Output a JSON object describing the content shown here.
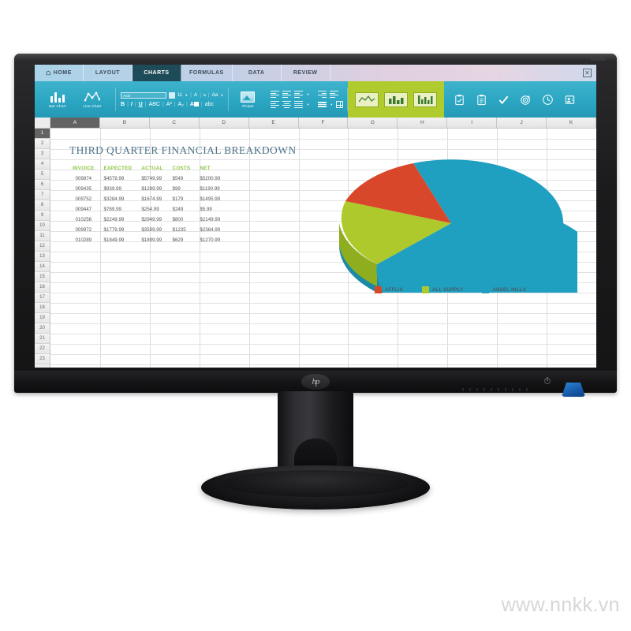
{
  "product": {
    "brand": "hp",
    "model_text": "N246v",
    "power_icon": "power-icon"
  },
  "screen": {
    "tabs": [
      {
        "label": "HOME",
        "icon": "home-icon",
        "active": false
      },
      {
        "label": "LAYOUT",
        "icon": "",
        "active": false
      },
      {
        "label": "CHARTS",
        "icon": "",
        "active": true
      },
      {
        "label": "FORMULAS",
        "icon": "",
        "active": false
      },
      {
        "label": "DATA",
        "icon": "",
        "active": false
      },
      {
        "label": "REVIEW",
        "icon": "",
        "active": false
      }
    ],
    "close_label": "✕",
    "ribbon": {
      "bar_chart_label": "Bar Chart",
      "line_chart_label": "Line Chart",
      "font_name": "Arial",
      "font_size": "11",
      "bold": "B",
      "italic": "I",
      "underline": "U",
      "strikethrough": "ABC",
      "superscript": "A²",
      "subscript": "A₂",
      "font_color_label": "A",
      "lowercase_label": "abc",
      "grow_font": "A",
      "shrink_font": "a",
      "change_case": "Aa",
      "picture_label": "Picture",
      "chart_chips": [
        "line-chart-chip",
        "bar-chart-chip",
        "column-chart-chip"
      ],
      "right_icons": [
        "clipboard-check-icon",
        "clipboard-list-icon",
        "check-icon",
        "target-icon",
        "clock-icon",
        "contact-card-icon"
      ]
    },
    "columns": [
      "A",
      "B",
      "C",
      "D",
      "E",
      "F",
      "G",
      "H",
      "I",
      "J",
      "K"
    ],
    "selected_column": "A",
    "rows": [
      1,
      2,
      3,
      4,
      5,
      6,
      7,
      8,
      9,
      10,
      11,
      12,
      13,
      14,
      15,
      16,
      17,
      18,
      19,
      20,
      21,
      22,
      23
    ],
    "selected_row": 1,
    "sheet_title": "THIRD QUARTER FINANCIAL BREAKDOWN",
    "table": {
      "headers": [
        "INVOICE",
        "EXPECTED",
        "ACTUAL",
        "COSTS",
        "NET"
      ],
      "rows": [
        [
          "009874",
          "$4579.99",
          "$5749.99",
          "$549",
          "$5200.99"
        ],
        [
          "009435",
          "$939.99",
          "$1289.99",
          "$99",
          "$1190.99"
        ],
        [
          "009752",
          "$3284.99",
          "$1674.99",
          "$179",
          "$1495.99"
        ],
        [
          "009447",
          "$789.99",
          "$254.99",
          "$249",
          "$5.99"
        ],
        [
          "010256",
          "$2249.99",
          "$2949.99",
          "$800",
          "$2149.99"
        ],
        [
          "009972",
          "$1779.99",
          "$3599.99",
          "$1235",
          "$2364.99"
        ],
        [
          "010289",
          "$1849.99",
          "$1899.99",
          "$629",
          "$1270.99"
        ]
      ]
    }
  },
  "chart_data": {
    "type": "pie",
    "title": "",
    "three_d": true,
    "legend_position": "bottom",
    "categories": [
      "AFFLIX",
      "ALL SUPPLY",
      "ANSEL HILLS"
    ],
    "values": [
      12,
      18,
      70
    ],
    "colors": [
      "#d9472b",
      "#aec92b",
      "#1fa0c0"
    ]
  },
  "theme": {
    "ribbon_teal": "#2ba6c2",
    "active_tab": "#1d4b57",
    "accent_green": "#b0cb2e",
    "header_green": "#8cc63e",
    "title_blue": "#4e7389",
    "pie_red": "#d9472b",
    "pie_lime": "#aec92b",
    "pie_teal": "#1fa0c0"
  },
  "watermark": "www.nnkk.vn"
}
